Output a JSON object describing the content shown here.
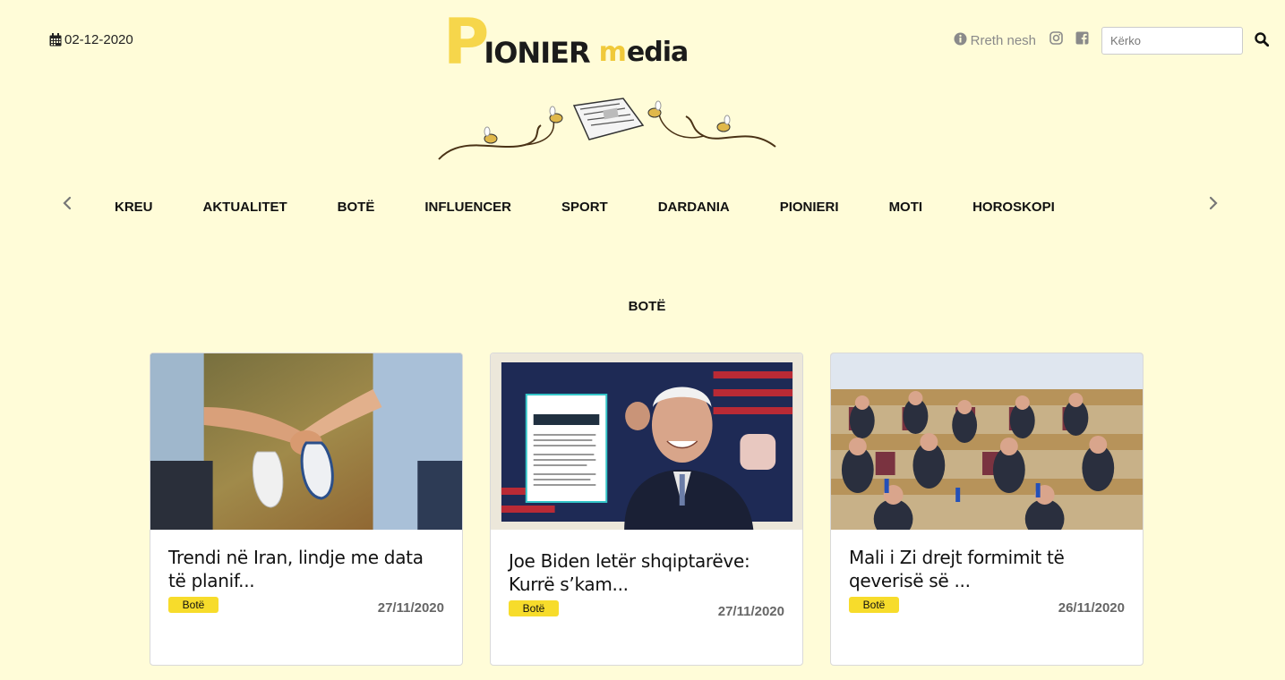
{
  "header": {
    "date": "02-12-2020",
    "logo": {
      "p": "P",
      "ionier": "IONIER",
      "m": "m",
      "edia": "edia"
    },
    "about_label": "Rreth nesh",
    "search_placeholder": "Kërko"
  },
  "nav": {
    "items": [
      "KREU",
      "AKTUALITET",
      "BOTË",
      "INFLUENCER",
      "SPORT",
      "DARDANIA",
      "PIONIERI",
      "MOTI",
      "HOROSKOPI"
    ]
  },
  "section": {
    "title": "BOTË"
  },
  "articles": [
    {
      "title": "Trendi në Iran, lindje me data të planif...",
      "category": "Botë",
      "date": "27/11/2020"
    },
    {
      "title": "Joe Biden letër shqiptarëve: Kurrë s’kam...",
      "category": "Botë",
      "date": "27/11/2020"
    },
    {
      "title": "Mali i Zi drejt formimit të qeverisë së ...",
      "category": "Botë",
      "date": "26/11/2020"
    }
  ],
  "colors": {
    "background": "#fffcd8",
    "accent": "#f6d64b",
    "badge": "#f7dc2b"
  }
}
